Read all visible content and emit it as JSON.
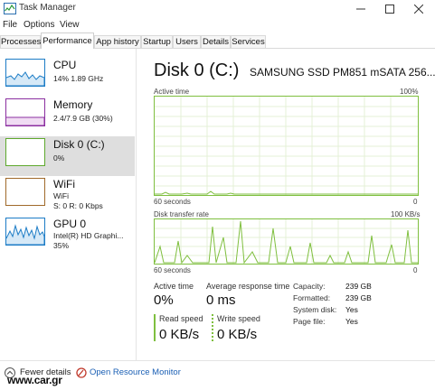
{
  "window": {
    "title": "Task Manager",
    "controls": [
      "minimize-icon",
      "maximize-icon",
      "close-icon"
    ]
  },
  "menu": [
    "File",
    "Options",
    "View"
  ],
  "tabs": [
    "Processes",
    "Performance",
    "App history",
    "Startup",
    "Users",
    "Details",
    "Services"
  ],
  "active_tab": "Performance",
  "sidebar": {
    "items": [
      {
        "title": "CPU",
        "line1": "14%  1.89 GHz",
        "line2": "",
        "color": "#1c7cc6"
      },
      {
        "title": "Memory",
        "line1": "2.4/7.9 GB (30%)",
        "line2": "",
        "color": "#8b2fa0"
      },
      {
        "title": "Disk 0 (C:)",
        "line1": "0%",
        "line2": "",
        "color": "#5ea82d"
      },
      {
        "title": "WiFi",
        "line1": "WiFi",
        "line2": "S: 0  R: 0 Kbps",
        "color": "#a0692a"
      },
      {
        "title": "GPU 0",
        "line1": "Intel(R) HD Graphi...",
        "line2": "35%",
        "color": "#1c7cc6"
      }
    ],
    "selected": "Disk 0 (C:)"
  },
  "main": {
    "title": "Disk 0 (C:)",
    "model": "SAMSUNG SSD PM851 mSATA 256...",
    "active_time_graph": {
      "label": "Active time",
      "max_label": "100%",
      "time_label": "60 seconds",
      "min_label": "0"
    },
    "transfer_graph": {
      "label": "Disk transfer rate",
      "max_label": "100 KB/s",
      "time_label": "60 seconds",
      "min_label": "0"
    },
    "stats": {
      "active_time_label": "Active time",
      "active_time_value": "0%",
      "avg_response_label": "Average response time",
      "avg_response_value": "0 ms",
      "read_speed_label": "Read speed",
      "read_speed_value": "0 KB/s",
      "write_speed_label": "Write speed",
      "write_speed_value": "0 KB/s"
    },
    "details": [
      {
        "key": "Capacity:",
        "value": "239 GB"
      },
      {
        "key": "Formatted:",
        "value": "239 GB"
      },
      {
        "key": "System disk:",
        "value": "Yes"
      },
      {
        "key": "Page file:",
        "value": "Yes"
      }
    ]
  },
  "footer": {
    "fewer_details": "Fewer details",
    "open_resource_monitor": "Open Resource Monitor",
    "watermark": "www.car.gr"
  },
  "accent_colors": {
    "disk": "#7fbf3f",
    "link": "#1a5fb4",
    "selected_bg": "#dedede"
  }
}
